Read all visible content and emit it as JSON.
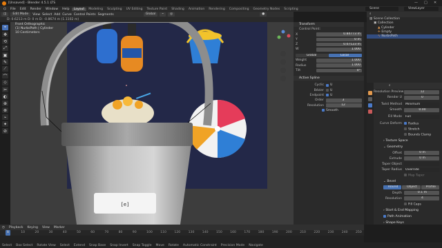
{
  "window": {
    "title": "[Unsaved] - Blender 4.5.1 LTS",
    "controls": [
      "—",
      "□",
      "✕"
    ]
  },
  "menu": [
    "File",
    "Edit",
    "Render",
    "Window",
    "Help"
  ],
  "workspaces": [
    "Layout",
    "Modeling",
    "Sculpting",
    "UV Editing",
    "Texture Paint",
    "Shading",
    "Animation",
    "Rendering",
    "Compositing",
    "Geometry Nodes",
    "Scripting"
  ],
  "active_workspace": "Layout",
  "scene": "Scene",
  "view_layer": "ViewLayer",
  "viewport_header": {
    "mode": "Edit Mode",
    "items": [
      "View",
      "Select",
      "Add",
      "Curve",
      "Control Points",
      "Segments"
    ],
    "orientation": "Global"
  },
  "status_info": "D: 0.6213 m  D: 0 m  D: -0.8674 m (1.1102 m)",
  "overlay": {
    "line1": "Front Orthographic",
    "line2": "(1) NurbsPath | Cylinder",
    "line3": "10 Centimeters"
  },
  "tools": [
    "⌖",
    "✥",
    "⟲",
    "⤢",
    "▣",
    "✎",
    "⟋",
    "⌒",
    "⬦",
    "✂",
    "◐",
    "⊕",
    "⊗",
    "⌁",
    "✦",
    "⊘"
  ],
  "npanel": {
    "transform": "Transform",
    "control_point": "Control Point:",
    "rows": [
      {
        "label": "X",
        "value": "0.84773 m"
      },
      {
        "label": "Y",
        "value": "0 m"
      },
      {
        "label": "Z",
        "value": "0.07123 m"
      },
      {
        "label": "W",
        "value": "1.000"
      }
    ],
    "toggle": [
      "Global",
      "Local"
    ],
    "rows2": [
      {
        "label": "Weight",
        "value": "1.000"
      },
      {
        "label": "Radius",
        "value": "1.000"
      },
      {
        "label": "Tilt",
        "value": "0°"
      }
    ],
    "active_spline": "Active Spline",
    "spline_rows": [
      {
        "label": "Cyclic",
        "value": "U"
      },
      {
        "label": "Bézier",
        "value": "U"
      },
      {
        "label": "Endpoint",
        "value": "U"
      },
      {
        "label": "Order",
        "value": "3"
      },
      {
        "label": "Resolution",
        "value": "12"
      }
    ],
    "smooth": "Smooth"
  },
  "outliner": {
    "search": "",
    "items": [
      {
        "name": "Scene Collection",
        "indent": 0,
        "selected": false
      },
      {
        "name": "Collection",
        "indent": 1,
        "selected": false
      },
      {
        "name": "Cylinder",
        "indent": 2,
        "selected": false
      },
      {
        "name": "Empty",
        "indent": 2,
        "selected": false
      },
      {
        "name": "NurbsPath",
        "indent": 2,
        "selected": true
      }
    ]
  },
  "properties": {
    "rows": [
      {
        "label": "Resolution Preview",
        "value": "12",
        "center": true
      },
      {
        "label": "Render U",
        "value": "0",
        "center": true
      },
      {
        "label": "Twist Method",
        "value": "Minimum",
        "center": false
      },
      {
        "label": "Smooth",
        "value": "0.00",
        "center": true
      },
      {
        "label": "Fill Mode",
        "value": "Full",
        "center": false
      }
    ],
    "curve_deform": "Curve Deform",
    "checks": [
      {
        "label": "Radius",
        "on": true
      },
      {
        "label": "Stretch",
        "on": false
      },
      {
        "label": "Bounds Clamp",
        "on": false
      }
    ],
    "texture_space": "Texture Space",
    "geometry": "Geometry",
    "geo_rows": [
      {
        "label": "Offset",
        "value": "0 m"
      },
      {
        "label": "Extrude",
        "value": "0 m"
      },
      {
        "label": "Taper Object",
        "value": ""
      },
      {
        "label": "Taper Radius",
        "value": "Override"
      }
    ],
    "map_taper": "Map Taper",
    "bevel": "Bevel",
    "bevel_tabs": [
      "Round",
      "Object",
      "Profile"
    ],
    "bevel_rows": [
      {
        "label": "Depth",
        "value": "0.1 m"
      },
      {
        "label": "Resolution",
        "value": "4"
      }
    ],
    "fill_caps": "Fill Caps",
    "sections": [
      "Start & End Mapping",
      "Path Animation",
      "Shape Keys"
    ]
  },
  "timeline": {
    "menus": [
      "Playback",
      "Keying",
      "View",
      "Marker"
    ],
    "ticks": [
      "0",
      "10",
      "20",
      "30",
      "40",
      "50",
      "60",
      "70",
      "80",
      "90",
      "100",
      "110",
      "120",
      "130",
      "140",
      "150",
      "160",
      "170",
      "180",
      "190",
      "200",
      "210",
      "220",
      "230",
      "240",
      "250"
    ],
    "current": "1"
  },
  "statusbar": [
    "Select",
    "Box Select",
    "Rotate View",
    "Select",
    "Extend",
    "Snap Base",
    "Snap Invert",
    "Snap Toggle",
    "Move",
    "Rotate",
    "Automatic Constraint",
    "Precision Mode",
    "Navigate"
  ],
  "mesh_label": "[e]",
  "colors": {
    "accent": "#4772b3",
    "selected_row": "#334d80",
    "viewport_bg": "#3d3d3d",
    "camera_bg": "#232848"
  }
}
